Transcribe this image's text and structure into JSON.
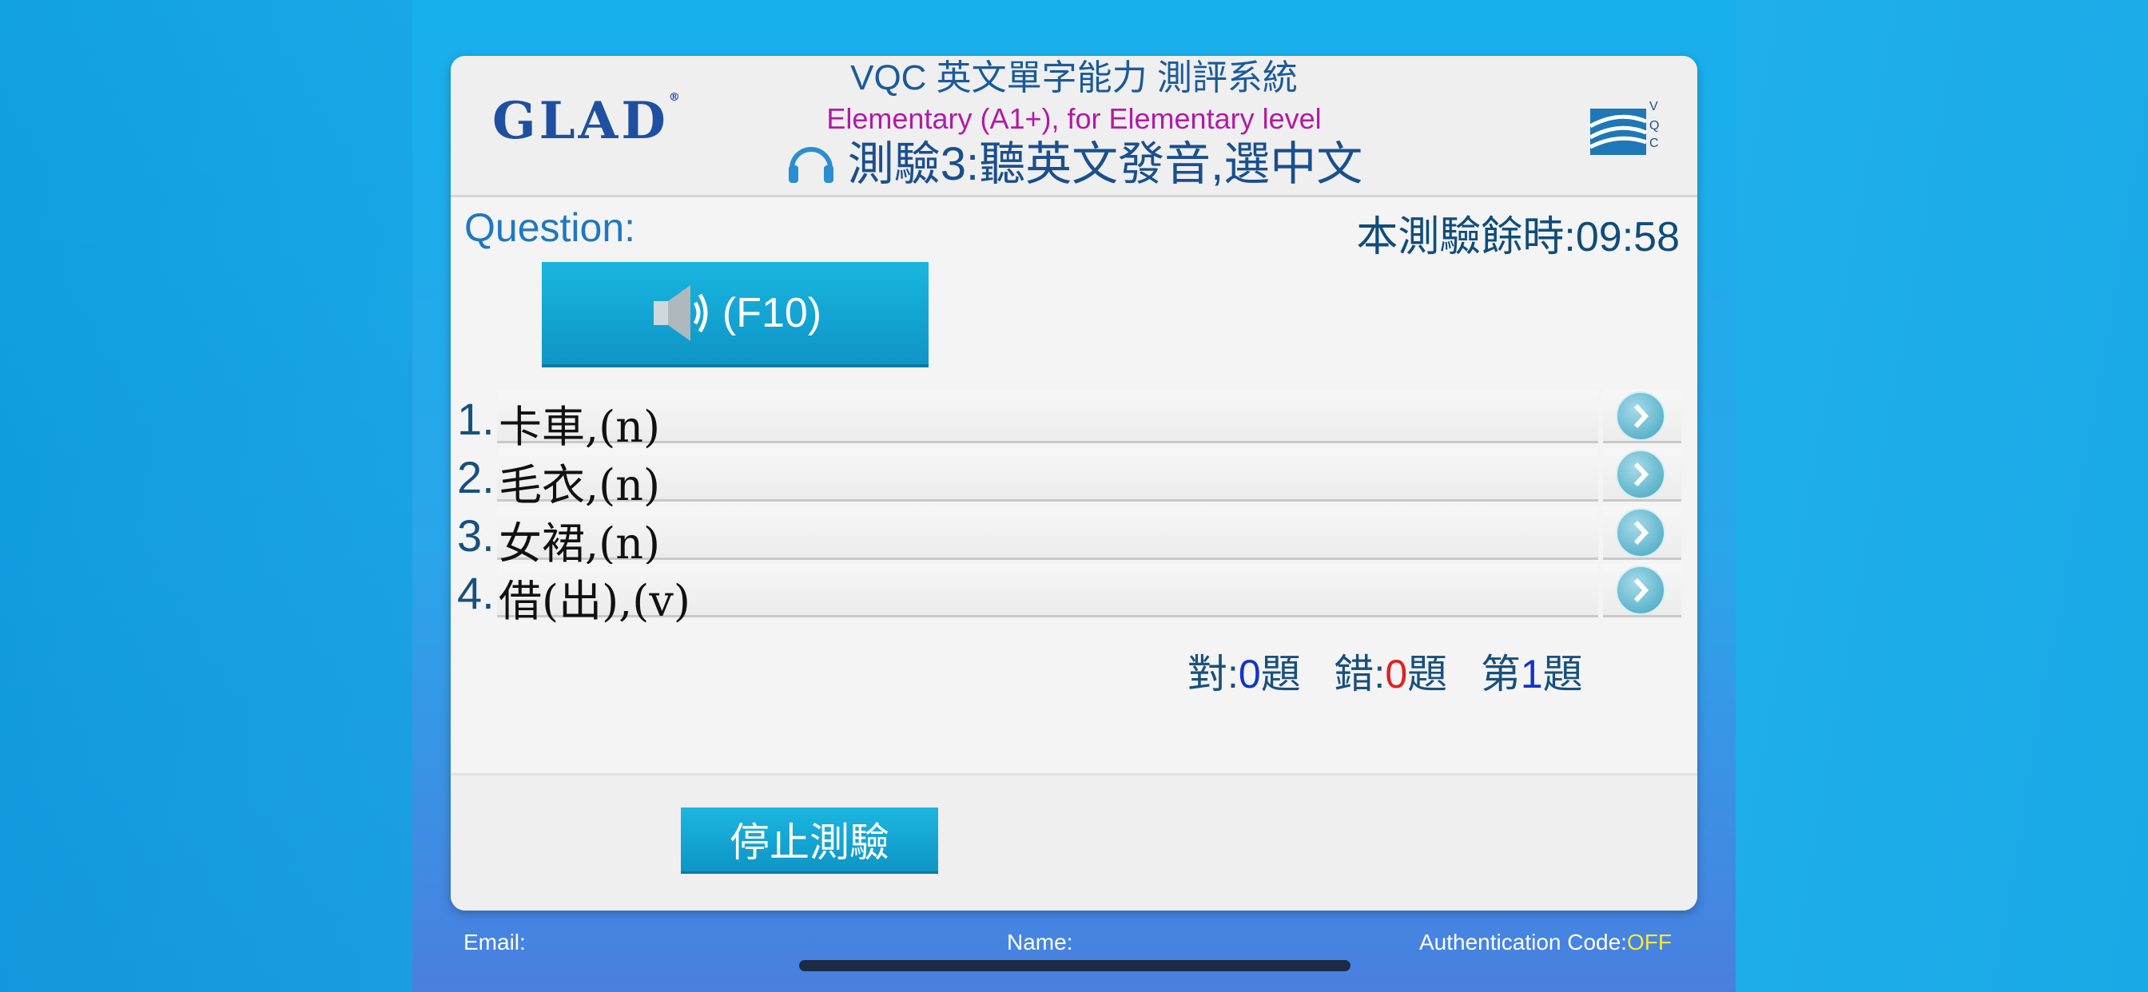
{
  "header": {
    "logo_left": "GLAD",
    "title": "VQC 英文單字能力 測評系統",
    "level": "Elementary (A1+), for Elementary level",
    "test_name": "測驗3:聽英文發音,選中文",
    "headphones_icon": "headphones-icon",
    "logo_right_icon": "book-logo-icon"
  },
  "question": {
    "label": "Question:",
    "timer": "本測驗餘時:09:58",
    "sound_button_label": "(F10)",
    "sound_icon": "speaker-icon"
  },
  "options": [
    {
      "num": "1.",
      "text": "卡車,(n)"
    },
    {
      "num": "2.",
      "text": "毛衣,(n)"
    },
    {
      "num": "3.",
      "text": "女裙,(n)"
    },
    {
      "num": "4.",
      "text": "借(出),(v)"
    }
  ],
  "score": {
    "correct_label": "對:",
    "correct": "0",
    "correct_unit": "題",
    "wrong_label": "錯:",
    "wrong": "0",
    "wrong_unit": "題",
    "index_label": "第",
    "index": "1",
    "index_unit": "題"
  },
  "actions": {
    "stop_label": "停止測驗"
  },
  "footer": {
    "email_label": "Email:",
    "name_label": "Name:",
    "auth_label": "Authentication Code:",
    "auth_value": "OFF"
  },
  "colors": {
    "accent": "#0e95c6",
    "title_blue": "#1a5a9a",
    "level_magenta": "#b21aa6",
    "correct_blue": "#1233cc",
    "wrong_red": "#e02020",
    "auth_yellow": "#f6e93a"
  }
}
